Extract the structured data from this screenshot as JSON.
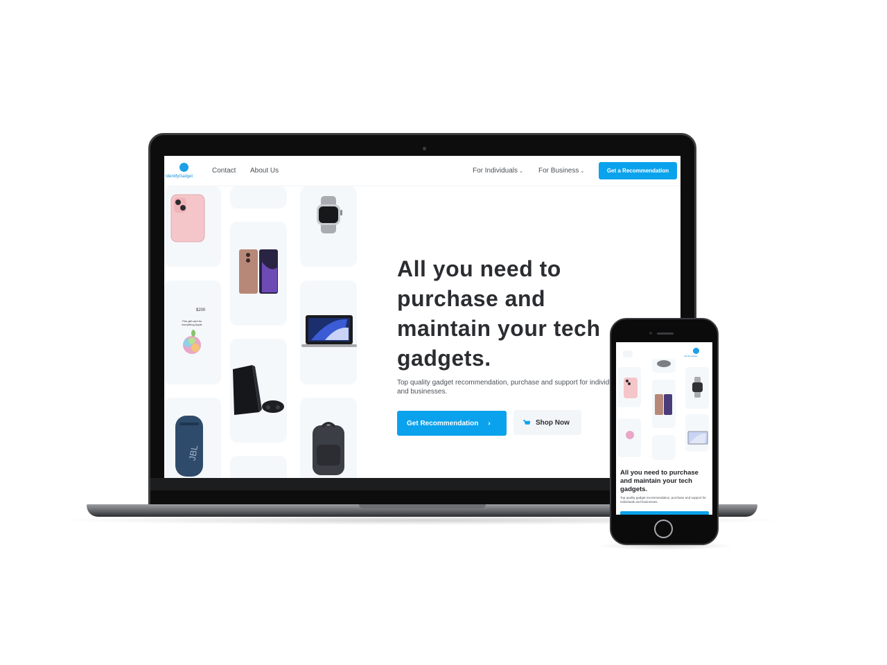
{
  "nav": {
    "logo_text": "IdentifyGadget",
    "contact": "Contact",
    "about": "About Us",
    "individuals": "For Individuals",
    "business": "For Business",
    "cta": "Get a Recommendation"
  },
  "hero": {
    "title_lines": [
      "All you need to",
      "purchase and",
      "maintain your tech",
      "gadgets."
    ],
    "subtitle": "Top quality gadget recommendation, purchase and support for individuals and businesses.",
    "primary_button": "Get Recommendation",
    "secondary_button": "Shop Now"
  },
  "products": {
    "gift_card_amount": "$200",
    "gift_card_text": "This gift card for everything Apple",
    "speaker_brand": "JBL"
  },
  "mobile": {
    "title": "All you need to purchase and maintain your tech gadgets.",
    "subtitle": "Top quality gadget recommendation, purchase and support for individuals and businesses."
  },
  "colors": {
    "accent": "#0aa2ec",
    "heading": "#2b2d31",
    "tile_bg": "#f5f8fb"
  }
}
